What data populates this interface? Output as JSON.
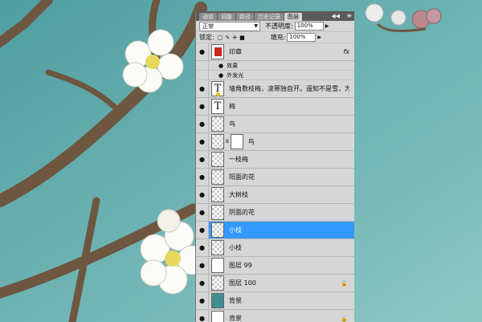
{
  "tabs": [
    "通道",
    "调整",
    "路径",
    "历史记录",
    "图层"
  ],
  "panel_menu_icon": "≡",
  "collapse_icon": "◀◀",
  "blend_mode": "正常",
  "opacity_label": "不透明度:",
  "opacity_value": "100%",
  "lock_label": "锁定:",
  "fill_label": "填充:",
  "fill_value": "100%",
  "layers": [
    {
      "name": "印章",
      "fx": "fx"
    },
    {
      "name": "墙角数枝梅，凌寒独自开。遥知不是雪，为有暗..."
    },
    {
      "name": "梅"
    },
    {
      "name": "鸟"
    },
    {
      "name": "鸟"
    },
    {
      "name": "一枝梅"
    },
    {
      "name": "阳面的花"
    },
    {
      "name": "大树枝"
    },
    {
      "name": "阴面的花"
    },
    {
      "name": "小枝"
    },
    {
      "name": "小枝"
    },
    {
      "name": "图层 99"
    },
    {
      "name": "图层 100"
    },
    {
      "name": "背景"
    },
    {
      "name": "背景"
    }
  ],
  "effects_label": "效果",
  "effect_name": "外发光",
  "colors": {
    "sky": "#5fa6a8",
    "selection": "#3399ff",
    "branch": "#6e5640"
  }
}
